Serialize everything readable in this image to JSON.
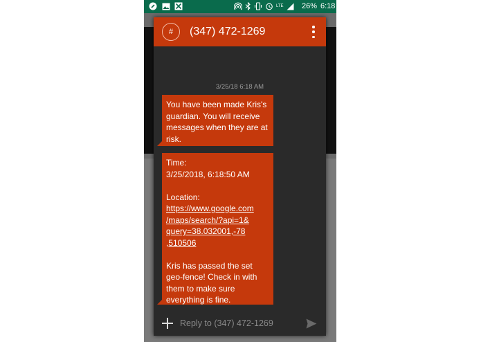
{
  "status_bar": {
    "battery_text": "26%",
    "time": "6:18",
    "lte_label": "LTE"
  },
  "conversation": {
    "contact_avatar_symbol": "#",
    "contact_name": "(347) 472-1269",
    "timestamp": "3/25/18 6:18 AM",
    "messages": [
      {
        "lines": [
          "You have been made Kris's guardian. You will receive messages when they are at risk."
        ]
      },
      {
        "time_label": "Time:",
        "time_value": "3/25/2018, 6:18:50 AM",
        "location_label": "Location:",
        "location_link": "https://www.google.com/maps/search/?api=1&query=38.032001,-78.510506",
        "location_link_lines": [
          "https://www.google.com",
          "/maps/search/?api=1&",
          "query=38.032001,-78",
          ",510506"
        ],
        "closing_text": "Kris has passed the set geo-fence! Check in with them to make sure everything is fine."
      }
    ]
  },
  "composer": {
    "placeholder": "Reply to (347) 472-1269"
  },
  "colors": {
    "accent": "#c5390c",
    "status_bar": "#0a6b4c",
    "dialog_bg": "#2a2a2a"
  },
  "icons": {
    "status_left": [
      "app-notification-icon",
      "image-icon",
      "close-box-icon"
    ],
    "status_right": [
      "hotspot-icon",
      "bluetooth-icon",
      "vibrate-icon",
      "alarm-icon",
      "signal-icon",
      "battery-icon"
    ],
    "header": "overflow-menu-icon",
    "composer": [
      "add-attachment-icon",
      "send-icon"
    ]
  }
}
